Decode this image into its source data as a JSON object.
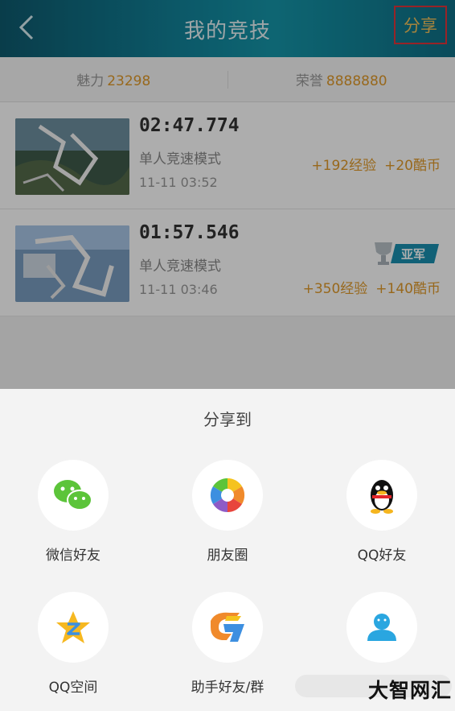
{
  "header": {
    "title": "我的竞技",
    "share_label": "分享"
  },
  "stats": {
    "charm_label": "魅力",
    "charm_value": "23298",
    "honor_label": "荣誉",
    "honor_value": "8888880"
  },
  "records": [
    {
      "time": "02:47.774",
      "mode": "单人竞速模式",
      "date": "11-11 03:52",
      "exp": "+192经验",
      "coins": "+20酷币"
    },
    {
      "time": "01:57.546",
      "mode": "单人竞速模式",
      "date": "11-11 03:46",
      "exp": "+350经验",
      "coins": "+140酷币",
      "badge": "亚军"
    }
  ],
  "share_sheet": {
    "title": "分享到",
    "options": [
      {
        "label": "微信好友",
        "icon": "wechat-icon"
      },
      {
        "label": "朋友圈",
        "icon": "moments-icon"
      },
      {
        "label": "QQ好友",
        "icon": "qq-icon"
      },
      {
        "label": "QQ空间",
        "icon": "qzone-icon"
      },
      {
        "label": "助手好友/群",
        "icon": "assistant-icon"
      },
      {
        "label": "",
        "icon": "contact-icon"
      }
    ]
  },
  "watermark": "大智网汇",
  "colors": {
    "accent": "#e09a2a",
    "header": "#1596a9",
    "share_highlight": "#e0343a"
  }
}
